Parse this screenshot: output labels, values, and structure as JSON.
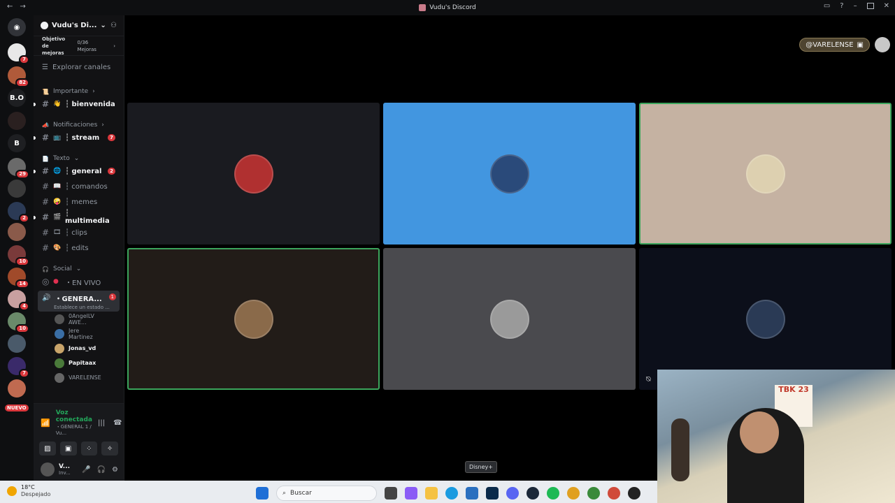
{
  "window": {
    "title": "Vudu's Discord"
  },
  "servers": [
    {
      "label": "",
      "badge": "7",
      "color": "#e8e8e8"
    },
    {
      "label": "",
      "badge": "82",
      "color": "#b05a3a"
    },
    {
      "label": "B.O",
      "badge": "",
      "color": "#1e1f22"
    },
    {
      "label": "",
      "badge": "",
      "color": "#2a2020"
    },
    {
      "label": "B",
      "badge": "",
      "color": "#1e1f22"
    },
    {
      "label": "",
      "badge": "29",
      "color": "#6a6a6a"
    },
    {
      "label": "",
      "badge": "",
      "color": "#3a3a3a"
    },
    {
      "label": "",
      "badge": "2",
      "color": "#2b3a55"
    },
    {
      "label": "",
      "badge": "",
      "color": "#8a5a4a"
    },
    {
      "label": "",
      "badge": "10",
      "color": "#7a3a3a"
    },
    {
      "label": "",
      "badge": "14",
      "color": "#a04a2a"
    },
    {
      "label": "",
      "badge": "4",
      "color": "#c8a0a0"
    },
    {
      "label": "",
      "badge": "10",
      "color": "#6a8a6a"
    },
    {
      "label": "",
      "badge": "",
      "color": "#4a5a6a"
    },
    {
      "label": "",
      "badge": "7",
      "color": "#3a2a6a"
    },
    {
      "label": "",
      "badge": "",
      "color": "#c06a50"
    }
  ],
  "nuevo": "NUEVO",
  "guild": {
    "name": "Vudu's Di...",
    "boost_goal": "Objetivo de mejoras",
    "boost_count": "0/36 Mejoras",
    "explore": "Explorar canales"
  },
  "categories": {
    "importante": "Importante",
    "notificaciones": "Notificaciones",
    "texto": "Texto",
    "social": "Social"
  },
  "channels": {
    "bienvenida": {
      "name": "┆ bienvenida",
      "emoji": "👋"
    },
    "stream": {
      "name": "┆ stream",
      "badge": "7"
    },
    "general": {
      "name": "┆ general",
      "badge": "2"
    },
    "comandos": {
      "name": "┆ comandos"
    },
    "memes": {
      "name": "┆ memes"
    },
    "multimedia": {
      "name": "┆ multimedia"
    },
    "clips": {
      "name": "┆ clips"
    },
    "edits": {
      "name": "┆ edits"
    },
    "envivo": {
      "name": "・EN VIVO"
    },
    "general_voice": {
      "name": "・GENERA...",
      "status": "Establece un estado ...",
      "badge": "1"
    }
  },
  "voice_users": [
    {
      "name": "0AngelLV AWE...",
      "bright": false,
      "color": "#555"
    },
    {
      "name": "Jere Martinez",
      "bright": false,
      "color": "#3a6ea5"
    },
    {
      "name": "Jonas_vd",
      "bright": true,
      "color": "#c9a46a"
    },
    {
      "name": "Papitaax",
      "bright": true,
      "color": "#4a7a3a"
    },
    {
      "name": "VARELENSE",
      "bright": false,
      "color": "#666"
    }
  ],
  "voice_panel": {
    "status": "Voz conectada",
    "channel": "・GENERAL 1 / Vu..."
  },
  "me": {
    "name": "V...",
    "status": "Inv..."
  },
  "stage": {
    "user_pill": "@VARELENSE"
  },
  "tiles": [
    {
      "bg": "#1a1b20",
      "avatar": "#b03030",
      "speaking": false
    },
    {
      "bg": "#4296e0",
      "avatar": "#2a4a7a",
      "speaking": false
    },
    {
      "bg": "#c5b2a2",
      "avatar": "#ddd0b0",
      "speaking": true
    },
    {
      "bg": "#221c18",
      "avatar": "#8a6a4a",
      "speaking": true
    },
    {
      "bg": "#4a4a4e",
      "avatar": "#9a9a9a",
      "speaking": false
    },
    {
      "bg": "#0c0f1a",
      "avatar": "#2a3a55",
      "speaking": false
    }
  ],
  "tooltip": "Disney+",
  "webcam": {
    "poster_text": "TBK 23"
  },
  "taskbar": {
    "temp": "18°C",
    "weather": "Despejado",
    "search": "Buscar"
  }
}
